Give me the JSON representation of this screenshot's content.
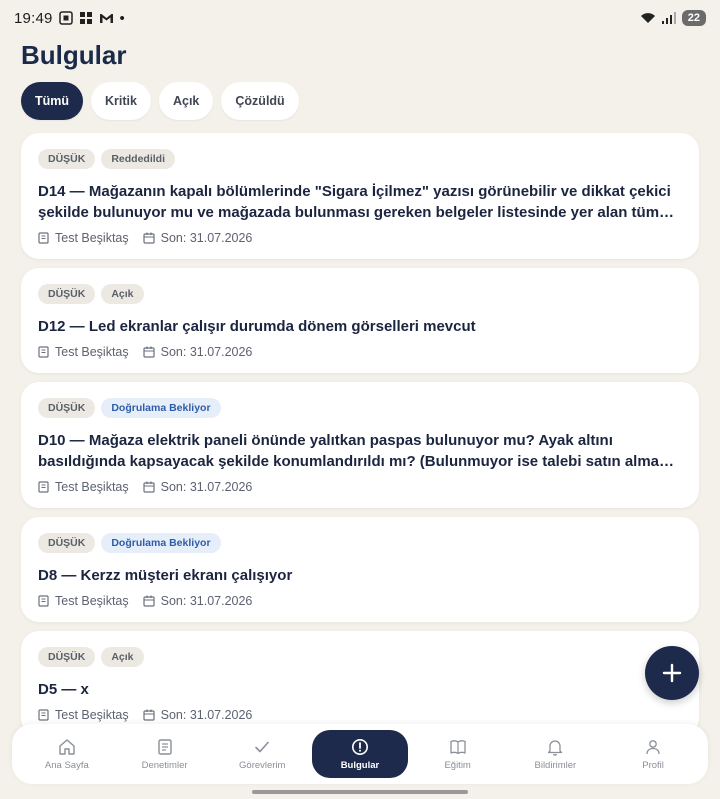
{
  "status_bar": {
    "time": "19:49",
    "dot": "•",
    "battery": "22"
  },
  "page": {
    "title": "Bulgular"
  },
  "filters": [
    {
      "label": "Tümü",
      "active": true
    },
    {
      "label": "Kritik",
      "active": false
    },
    {
      "label": "Açık",
      "active": false
    },
    {
      "label": "Çözüldü",
      "active": false
    }
  ],
  "findings": [
    {
      "severity": "DÜŞÜK",
      "status": "Reddedildi",
      "status_style": "grey",
      "title": "D14 — Mağazanın kapalı bölümlerinde \"Sigara İçilmez\" yazısı görünebilir ve dikkat çekici şekilde bulunuyor mu ve mağazada bulunması gereken belgeler listesinde yer alan tüm yasal …",
      "store": "Test Beşiktaş",
      "due": "Son: 31.07.2026"
    },
    {
      "severity": "DÜŞÜK",
      "status": "Açık",
      "status_style": "grey",
      "title": "D12 — Led ekranlar çalışır durumda dönem görselleri mevcut",
      "store": "Test Beşiktaş",
      "due": "Son: 31.07.2026"
    },
    {
      "severity": "DÜŞÜK",
      "status": "Doğrulama Bekliyor",
      "status_style": "blue",
      "title": "D10 — Mağaza elektrik paneli önünde yalıtkan paspas bulunuyor mu? Ayak altını basıldığında kapsayacak şekilde konumlandırıldı mı? (Bulunmuyor ise talebi satın alma departmanına mail …",
      "store": "Test Beşiktaş",
      "due": "Son: 31.07.2026"
    },
    {
      "severity": "DÜŞÜK",
      "status": "Doğrulama Bekliyor",
      "status_style": "blue",
      "title": "D8 — Kerzz müşteri ekranı çalışıyor",
      "store": "Test Beşiktaş",
      "due": "Son: 31.07.2026"
    },
    {
      "severity": "DÜŞÜK",
      "status": "Açık",
      "status_style": "grey",
      "title": "D5 — x",
      "store": "Test Beşiktaş",
      "due": "Son: 31.07.2026"
    }
  ],
  "fab": {
    "icon": "plus-icon"
  },
  "nav": [
    {
      "label": "Ana Sayfa",
      "icon": "home-icon",
      "active": false
    },
    {
      "label": "Denetimler",
      "icon": "clipboard-icon",
      "active": false
    },
    {
      "label": "Görevlerim",
      "icon": "check-icon",
      "active": false
    },
    {
      "label": "Bulgular",
      "icon": "alert-circle-icon",
      "active": true
    },
    {
      "label": "Eğitim",
      "icon": "book-icon",
      "active": false
    },
    {
      "label": "Bildirimler",
      "icon": "bell-icon",
      "active": false
    },
    {
      "label": "Profil",
      "icon": "user-icon",
      "active": false
    }
  ],
  "colors": {
    "background": "#f4f1ea",
    "primary": "#1d2a4c",
    "card": "#ffffff",
    "status_blue_text": "#2e5da8",
    "status_blue_bg": "#e6eef9"
  }
}
